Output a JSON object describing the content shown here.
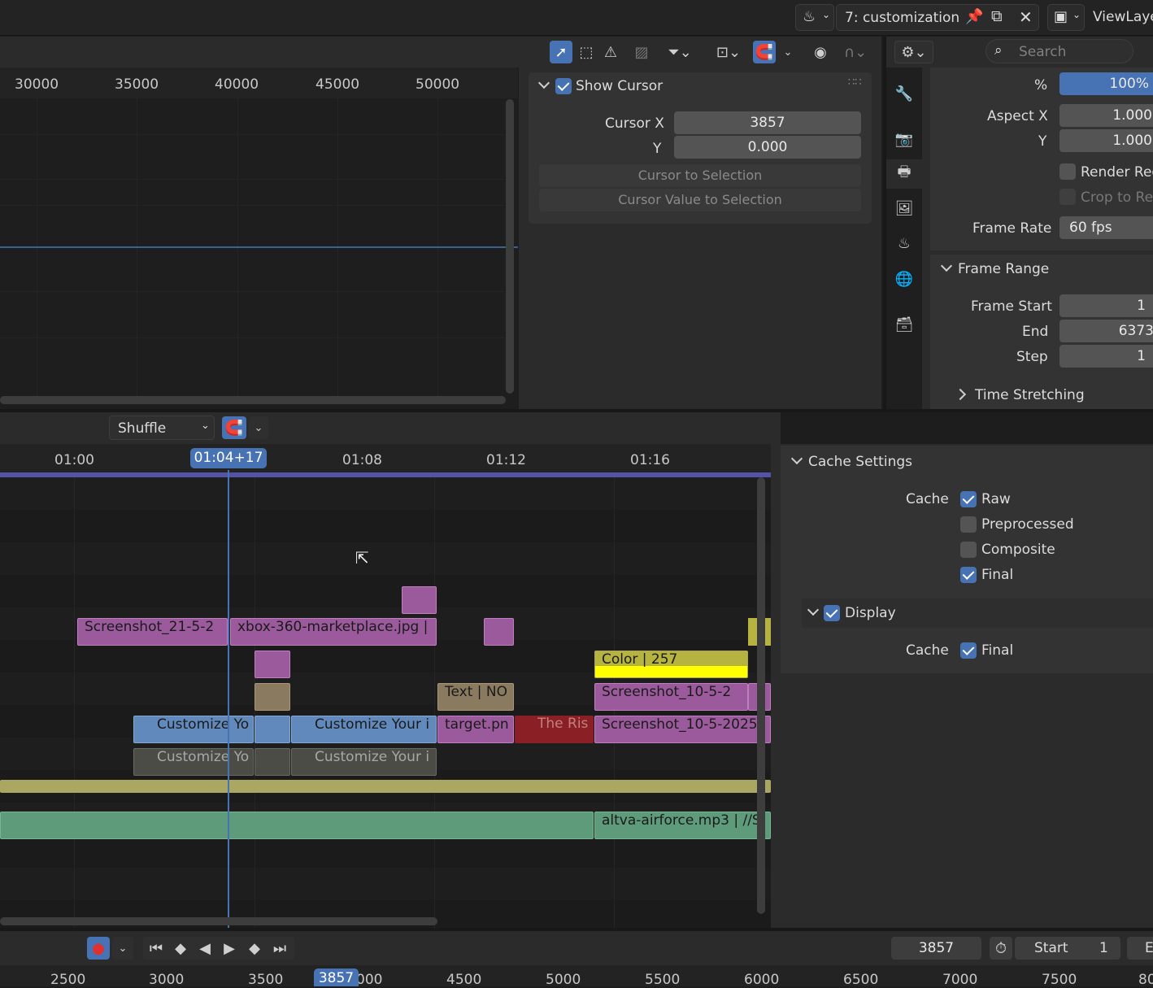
{
  "topbar": {
    "scene_name": "7: customization",
    "view_layer": "ViewLaye"
  },
  "graph": {
    "ruler": [
      "30000",
      "35000",
      "40000",
      "45000",
      "50000"
    ]
  },
  "view_panel": {
    "show_cursor_label": "Show Cursor",
    "show_cursor_checked": true,
    "cursor_x_label": "Cursor X",
    "cursor_x_value": "3857",
    "y_label": "Y",
    "y_value": "0.000",
    "btn_cursor_to_selection": "Cursor to Selection",
    "btn_cursor_value_to_selection": "Cursor Value to Selection"
  },
  "properties": {
    "search_placeholder": "Search",
    "percent_label": "%",
    "percent_value": "100%",
    "aspect_x_label": "Aspect X",
    "aspect_x_value": "1.000",
    "aspect_y_label": "Y",
    "aspect_y_value": "1.000",
    "render_region_label": "Render Reg",
    "crop_label": "Crop to Re",
    "frame_rate_label": "Frame Rate",
    "frame_rate_value": "60 fps",
    "frame_range_title": "Frame Range",
    "frame_start_label": "Frame Start",
    "frame_start_value": "1",
    "end_label": "End",
    "end_value": "6373",
    "step_label": "Step",
    "step_value": "1",
    "time_stretching_label": "Time Stretching"
  },
  "sequencer": {
    "overlap_mode": "Shuffle",
    "current_time": "01:04+17",
    "ruler": [
      "01:00",
      "01:08",
      "01:12",
      "01:16"
    ],
    "strips": {
      "screenshot_21": "Screenshot_21-5-2",
      "xbox": "xbox-360-marketplace.jpg |",
      "color": "Color | 257",
      "text_no": "Text | NO",
      "screenshot_10a": "Screenshot_10-5-2",
      "customize_1": "Customize Yo",
      "customize_2": "Customize Your i",
      "target": "target.pn",
      "the_ris": "The Ris",
      "screenshot_10b": "Screenshot_10-5-2025",
      "customize_snd_1": "Customize Yo",
      "customize_snd_2": "Customize Your i",
      "audio": "altva-airforce.mp3 | //S"
    }
  },
  "cache_panel": {
    "title": "Cache Settings",
    "cache_label": "Cache",
    "raw": "Raw",
    "raw_checked": true,
    "preprocessed": "Preprocessed",
    "preprocessed_checked": false,
    "composite": "Composite",
    "composite_checked": false,
    "final": "Final",
    "final_checked": true,
    "display_title": "Display",
    "display_checked": true,
    "display_cache_label": "Cache",
    "display_final": "Final",
    "display_final_checked": true
  },
  "timeline": {
    "current_frame": "3857",
    "start_label": "Start",
    "start_value": "1",
    "end_label_partial": "E",
    "ruler": [
      "2500",
      "3000",
      "3500",
      "3857",
      "000",
      "4500",
      "5000",
      "5500",
      "6000",
      "6500",
      "7000",
      "7500",
      "80"
    ]
  }
}
